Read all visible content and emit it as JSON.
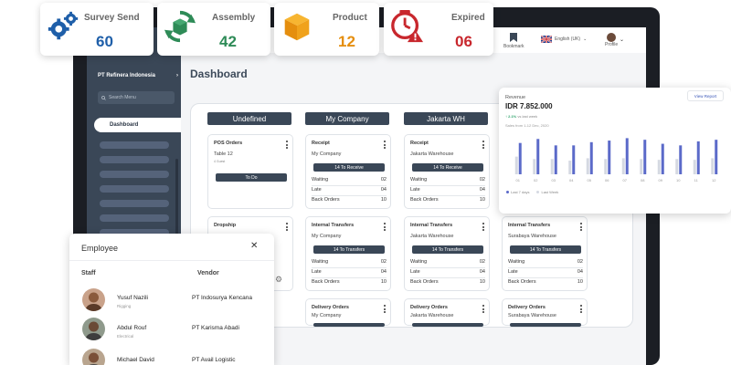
{
  "stats": [
    {
      "label": "Survey Send",
      "value": "60",
      "value_color": "#1f5fa9",
      "icon": "gears-icon"
    },
    {
      "label": "Assembly",
      "value": "42",
      "value_color": "#2e8b57",
      "icon": "assembly-box-icon"
    },
    {
      "label": "Product",
      "value": "12",
      "value_color": "#e58e0e",
      "icon": "product-box-icon"
    },
    {
      "label": "Expired",
      "value": "06",
      "value_color": "#c8272d",
      "icon": "clock-alert-icon"
    }
  ],
  "sidebar": {
    "company": "PT Refinera Indonesia",
    "search_placeholder": "Search Menu",
    "active_item": "Dashboard"
  },
  "topbar": {
    "bookmark": "Bookmark",
    "language": "English (UK)",
    "profile": "Profile"
  },
  "dashboard": {
    "title": "Dashboard",
    "columns": [
      "Undefined",
      "My Company",
      "Jakarta WH",
      ""
    ],
    "cards": {
      "pos": {
        "title": "POS Orders",
        "sub": "Table 12",
        "note": "4 Guest",
        "button": "To Do"
      },
      "dropship": {
        "title": "Dropship"
      },
      "receipt_mc": {
        "title": "Receipt",
        "sub": "My Company",
        "button": "14 To Receive",
        "rows": [
          [
            "Waiting",
            "02"
          ],
          [
            "Late",
            "04"
          ],
          [
            "Back Orders",
            "10"
          ]
        ]
      },
      "receipt_jw": {
        "title": "Receipt",
        "sub": "Jakarta Warehouse",
        "button": "14 To Receive",
        "rows": [
          [
            "Waiting",
            "02"
          ],
          [
            "Late",
            "04"
          ],
          [
            "Back Orders",
            "10"
          ]
        ]
      },
      "transfer_mc": {
        "title": "Internal Transfers",
        "sub": "My Company",
        "button": "14 To Transfers",
        "rows": [
          [
            "Waiting",
            "02"
          ],
          [
            "Late",
            "04"
          ],
          [
            "Back Orders",
            "10"
          ]
        ]
      },
      "transfer_jw": {
        "title": "Internal Transfers",
        "sub": "Jakarta Warehouse",
        "button": "14 To Transfers",
        "rows": [
          [
            "Waiting",
            "02"
          ],
          [
            "Late",
            "04"
          ],
          [
            "Back Orders",
            "10"
          ]
        ]
      },
      "transfer_sw": {
        "title": "Internal Transfers",
        "sub": "Surabaya Warehouse",
        "button": "14 To Transfers",
        "rows": [
          [
            "Waiting",
            "02"
          ],
          [
            "Late",
            "04"
          ],
          [
            "Back Orders",
            "10"
          ]
        ]
      },
      "delivery_mc": {
        "title": "Delivery Orders",
        "sub": "My Company"
      },
      "delivery_jw": {
        "title": "Delivery Orders",
        "sub": "Jakarta Warehouse"
      },
      "delivery_sw": {
        "title": "Delivery Orders",
        "sub": "Surabaya Warehouse"
      }
    }
  },
  "revenue": {
    "title": "Revenue",
    "amount": "IDR 7.852.000",
    "change": "2.1%",
    "change_suffix": "vs last week",
    "subtitle": "Sales from 1-12 Dec, 2020",
    "view_report": "View Report",
    "colors": {
      "primary": "#5b6ac9",
      "secondary": "#d5d9e2"
    }
  },
  "chart_data": {
    "type": "bar",
    "categories": [
      "01",
      "02",
      "03",
      "04",
      "05",
      "06",
      "07",
      "08",
      "09",
      "10",
      "11",
      "12"
    ],
    "series": [
      {
        "name": "Last 7 days",
        "values": [
          78,
          88,
          72,
          72,
          80,
          84,
          90,
          86,
          76,
          72,
          82,
          86
        ]
      },
      {
        "name": "Last Week",
        "values": [
          44,
          38,
          38,
          34,
          40,
          38,
          40,
          38,
          36,
          38,
          36,
          40
        ]
      }
    ],
    "title": "Revenue",
    "ylim": [
      0,
      100
    ],
    "grid": false,
    "legend": "bottom-left"
  },
  "employee": {
    "title": "Employee",
    "staff_header": "Staff",
    "vendor_header": "Vendor",
    "rows": [
      {
        "name": "Yusuf Nazili",
        "role": "Rigging",
        "vendor": "PT Indosurya Kencana"
      },
      {
        "name": "Abdul Rouf",
        "role": "Electrical",
        "vendor": "PT Karisma Abadi"
      },
      {
        "name": "Michael David",
        "role": "",
        "vendor": "PT Avail Logistic"
      }
    ]
  }
}
